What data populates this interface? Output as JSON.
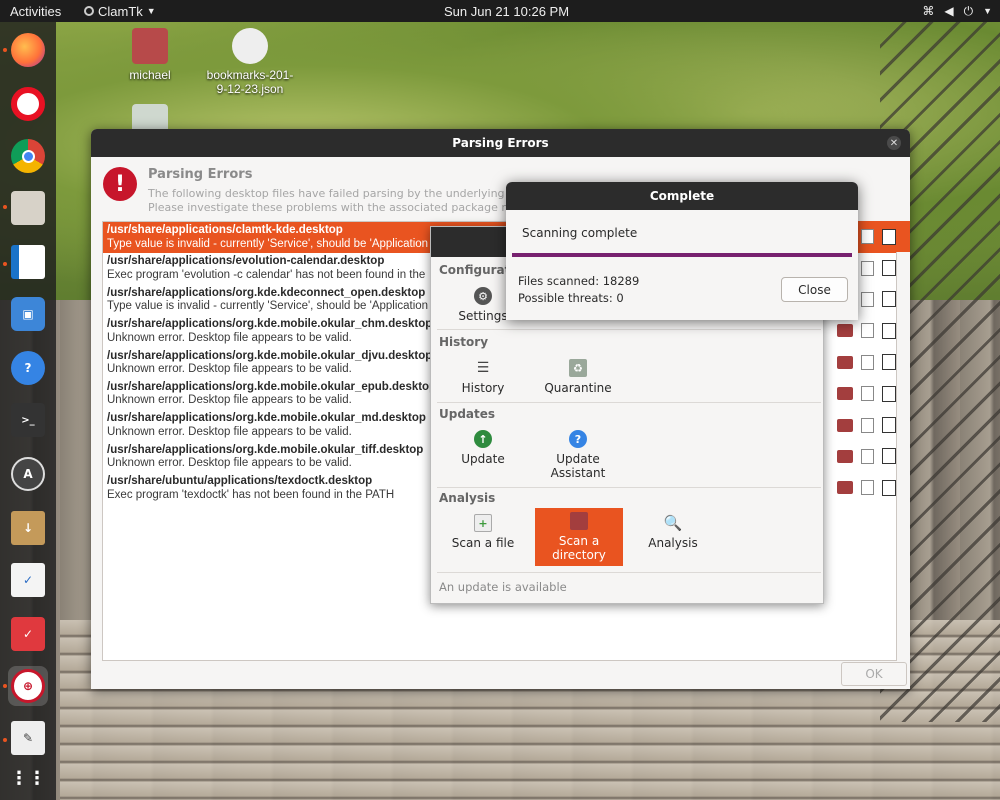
{
  "topbar": {
    "activities": "Activities",
    "app_name": "ClamTk",
    "clock": "Sun Jun 21  10:26 PM"
  },
  "desktop": {
    "icons": [
      {
        "label": "michael"
      },
      {
        "label": "bookmarks-201-9-12-23.json"
      }
    ]
  },
  "parsing_errors": {
    "window_title": "Parsing Errors",
    "heading": "Parsing Errors",
    "description_line1": "The following desktop files have failed parsing by the underlying libra",
    "description_line2": "Please investigate these problems with the associated package main",
    "rows": [
      {
        "path": "/usr/share/applications/clamtk-kde.desktop",
        "message": "Type value is invalid - currently 'Service', should be 'Application",
        "selected": true
      },
      {
        "path": "/usr/share/applications/evolution-calendar.desktop",
        "message": "Exec program 'evolution -c calendar' has not been found in the",
        "selected": false
      },
      {
        "path": "/usr/share/applications/org.kde.kdeconnect_open.desktop",
        "message": "Type value is invalid - currently 'Service', should be 'Application",
        "selected": false
      },
      {
        "path": "/usr/share/applications/org.kde.mobile.okular_chm.desktop",
        "message": "Unknown error. Desktop file appears to be valid.",
        "selected": false
      },
      {
        "path": "/usr/share/applications/org.kde.mobile.okular_djvu.desktop",
        "message": "Unknown error. Desktop file appears to be valid.",
        "selected": false
      },
      {
        "path": "/usr/share/applications/org.kde.mobile.okular_epub.desktop",
        "message": "Unknown error. Desktop file appears to be valid.",
        "selected": false
      },
      {
        "path": "/usr/share/applications/org.kde.mobile.okular_md.desktop",
        "message": "Unknown error. Desktop file appears to be valid.",
        "selected": false
      },
      {
        "path": "/usr/share/applications/org.kde.mobile.okular_tiff.desktop",
        "message": "Unknown error. Desktop file appears to be valid.",
        "selected": false
      },
      {
        "path": "/usr/share/ubuntu/applications/texdoctk.desktop",
        "message": "Exec program 'texdoctk' has not been found in the PATH",
        "selected": false
      }
    ],
    "ok_label": "OK"
  },
  "clamtk": {
    "sections": {
      "configuration": "Configuration",
      "history": "History",
      "updates": "Updates",
      "analysis": "Analysis"
    },
    "items": {
      "settings": "Settings",
      "history": "History",
      "quarantine": "Quarantine",
      "update": "Update",
      "update_assistant": "Update Assistant",
      "scan_file": "Scan a file",
      "scan_directory": "Scan a directory",
      "analysis": "Analysis"
    },
    "status": "An update is available"
  },
  "complete_dialog": {
    "title": "Complete",
    "message": "Scanning complete",
    "progress": 1.0,
    "files_scanned": "Files scanned: 18289",
    "possible_threats": "Possible threats: 0",
    "close_label": "Close"
  }
}
